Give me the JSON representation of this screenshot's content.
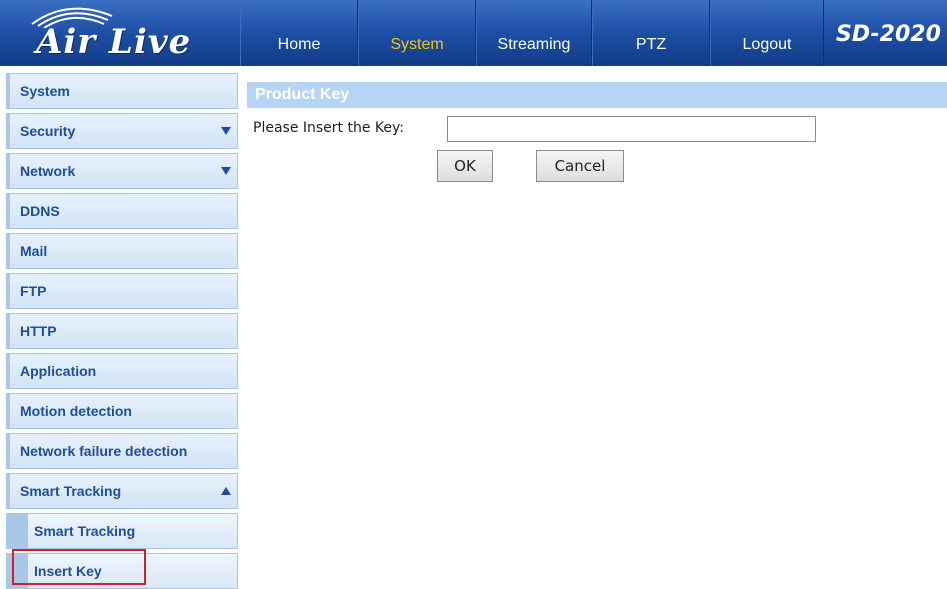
{
  "header": {
    "logo_text": "Air Live",
    "model": "SD-2020",
    "nav": [
      {
        "label": "Home",
        "active": false
      },
      {
        "label": "System",
        "active": true
      },
      {
        "label": "Streaming",
        "active": false
      },
      {
        "label": "PTZ",
        "active": false
      },
      {
        "label": "Logout",
        "active": false
      }
    ]
  },
  "sidebar": {
    "items": [
      {
        "label": "System",
        "arrow": ""
      },
      {
        "label": "Security",
        "arrow": "down"
      },
      {
        "label": "Network",
        "arrow": "down"
      },
      {
        "label": "DDNS",
        "arrow": ""
      },
      {
        "label": "Mail",
        "arrow": ""
      },
      {
        "label": "FTP",
        "arrow": ""
      },
      {
        "label": "HTTP",
        "arrow": ""
      },
      {
        "label": "Application",
        "arrow": ""
      },
      {
        "label": "Motion detection",
        "arrow": ""
      },
      {
        "label": "Network failure detection",
        "arrow": ""
      },
      {
        "label": "Smart Tracking",
        "arrow": "up"
      }
    ],
    "sub_items": [
      {
        "label": "Smart Tracking"
      },
      {
        "label": "Insert Key"
      }
    ]
  },
  "main": {
    "section_title": "Product Key",
    "key_label": "Please Insert the Key:",
    "key_value": "",
    "ok_label": "OK",
    "cancel_label": "Cancel"
  },
  "colors": {
    "header_blue": "#1d4fa5",
    "active_nav": "#f2c40c",
    "sidebar_text": "#1f4e9a",
    "section_title_bg": "#b6d4f3",
    "highlight_red": "#d02030"
  }
}
